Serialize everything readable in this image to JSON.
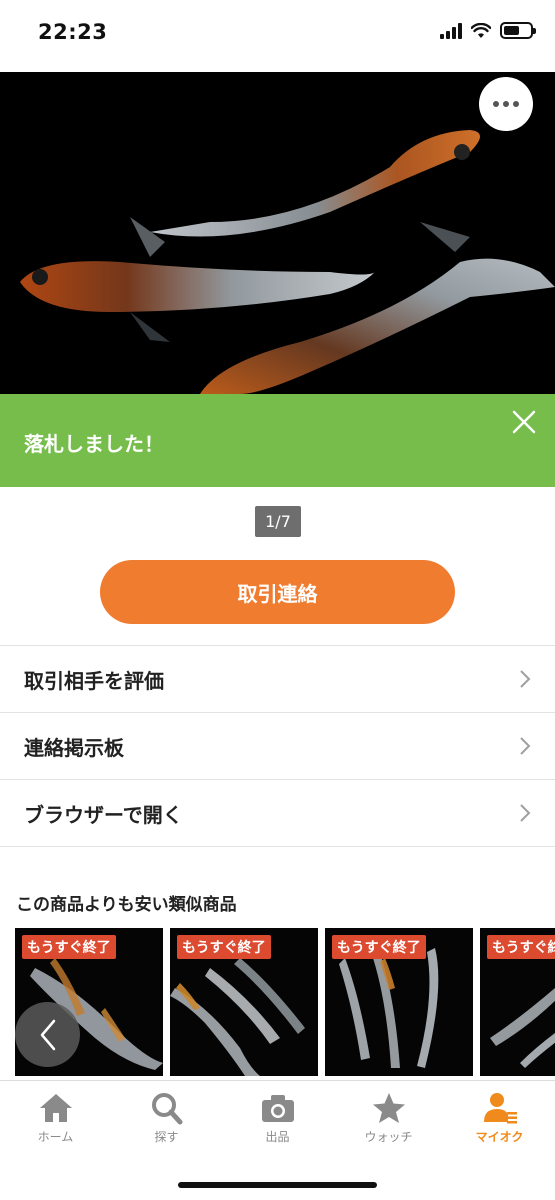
{
  "status_bar": {
    "time": "22:23"
  },
  "hero": {
    "page_indicator": "1/7"
  },
  "banner": {
    "message": "落札しました！"
  },
  "actions": {
    "contact_label": "取引連絡"
  },
  "menu": {
    "items": [
      {
        "label": "取引相手を評価"
      },
      {
        "label": "連絡掲示板"
      },
      {
        "label": "ブラウザーで開く"
      }
    ]
  },
  "similar": {
    "title": "この商品よりも安い類似商品",
    "items": [
      {
        "badge": "もうすぐ終了"
      },
      {
        "badge": "もうすぐ終了"
      },
      {
        "badge": "もうすぐ終了"
      },
      {
        "badge": "もうすぐ終了"
      }
    ]
  },
  "tab_bar": {
    "tabs": [
      {
        "label": "ホーム",
        "icon": "home-icon"
      },
      {
        "label": "探す",
        "icon": "search-icon"
      },
      {
        "label": "出品",
        "icon": "camera-icon"
      },
      {
        "label": "ウォッチ",
        "icon": "star-icon"
      },
      {
        "label": "マイオク",
        "icon": "user-icon"
      }
    ],
    "active_color": "#f08a1c",
    "inactive_color": "#8a8a8a"
  },
  "colors": {
    "banner": "#76bd4b",
    "accent": "#f07c30",
    "badge": "#dc4a30"
  }
}
